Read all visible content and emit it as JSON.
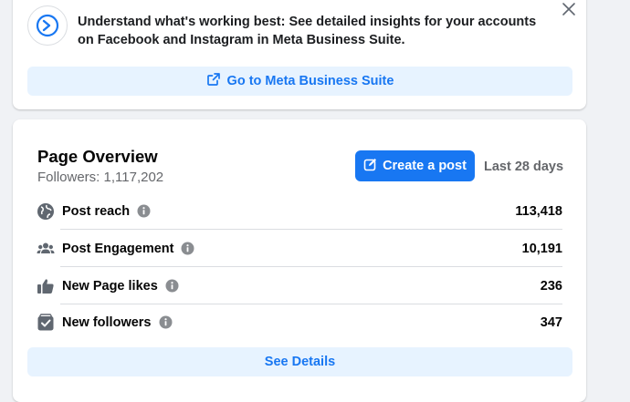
{
  "promo": {
    "message": "Understand what's working best: See detailed insights for your accounts on Facebook and Instagram in Meta Business Suite.",
    "button_label": "Go to Meta Business Suite",
    "logo_icon": "meta-business-suite-icon",
    "close_icon": "close-icon"
  },
  "overview": {
    "title": "Page Overview",
    "followers_text": "Followers: 1,117,202",
    "create_post_label": "Create a post",
    "date_range": "Last 28 days",
    "metrics": [
      {
        "label": "Post reach",
        "value": "113,418",
        "icon": "globe-icon"
      },
      {
        "label": "Post Engagement",
        "value": "10,191",
        "icon": "people-icon"
      },
      {
        "label": "New Page likes",
        "value": "236",
        "icon": "thumbs-up-icon"
      },
      {
        "label": "New followers",
        "value": "347",
        "icon": "follow-check-icon"
      }
    ],
    "details_label": "See Details"
  },
  "colors": {
    "accent": "#1877f2",
    "button_light": "#e7f3ff",
    "background": "#f0f2f5",
    "muted_text": "#65676b"
  }
}
